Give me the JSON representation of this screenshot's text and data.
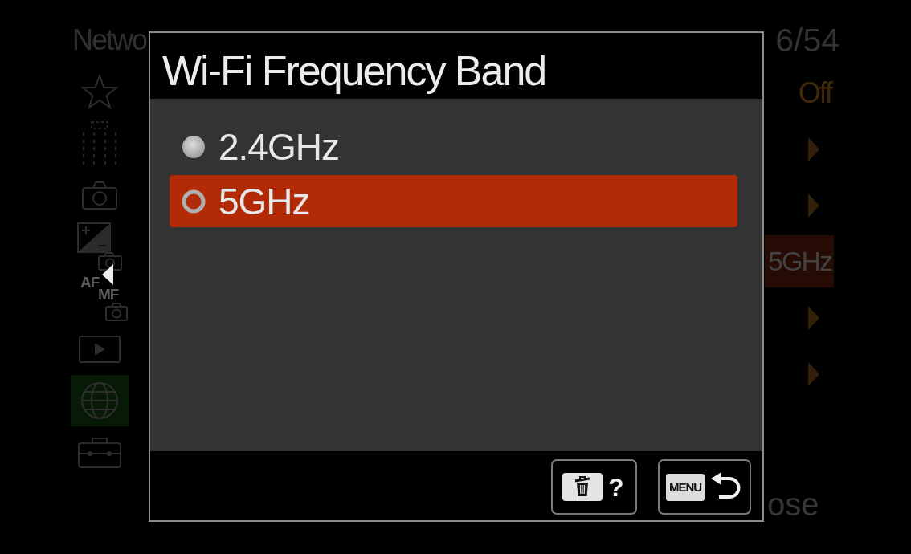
{
  "background_menu": {
    "title": "Netwo",
    "page": "6/54",
    "tabs": [
      {
        "kind": "star",
        "selected": false
      },
      {
        "kind": "grid",
        "selected": false
      },
      {
        "kind": "camera",
        "selected": false
      },
      {
        "kind": "exposure",
        "selected": false
      },
      {
        "kind": "af-mf",
        "labels": [
          "AF",
          "MF"
        ],
        "selected": false
      },
      {
        "kind": "play",
        "selected": false
      },
      {
        "kind": "globe",
        "selected": true
      },
      {
        "kind": "toolbox",
        "selected": false
      }
    ],
    "rows": [
      {
        "kind": "value",
        "value": "Off",
        "selected": false
      },
      {
        "kind": "arrow",
        "selected": false
      },
      {
        "kind": "arrow",
        "selected": false
      },
      {
        "kind": "value",
        "value": "5GHz",
        "selected": true
      },
      {
        "kind": "arrow",
        "selected": false
      },
      {
        "kind": "arrow",
        "selected": false
      }
    ],
    "footer_hint": "ose"
  },
  "dialog": {
    "title": "Wi-Fi Frequency Band",
    "options": [
      {
        "label": "2.4GHz",
        "selected": false
      },
      {
        "label": "5GHz",
        "selected": true
      }
    ],
    "buttons": [
      {
        "kind": "help",
        "label": "?"
      },
      {
        "kind": "back",
        "key": "MENU"
      }
    ]
  }
}
